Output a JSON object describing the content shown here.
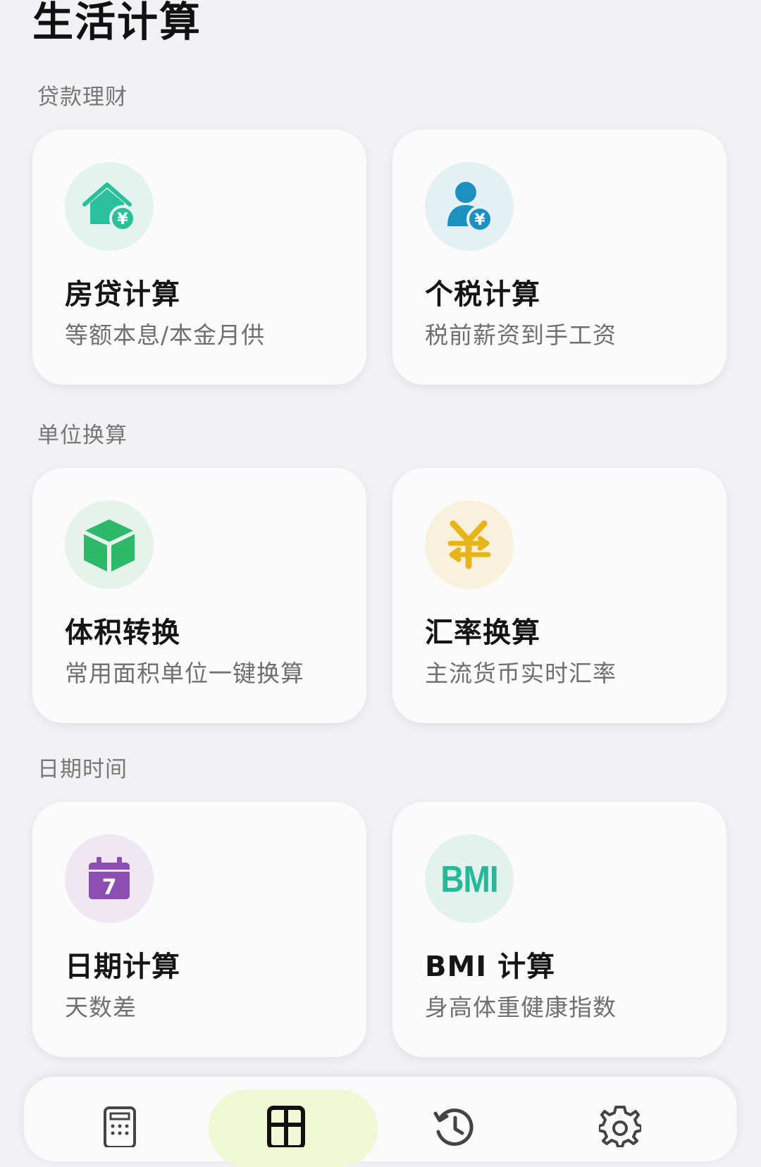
{
  "page": {
    "title": "生活计算"
  },
  "sections": [
    {
      "title": "贷款理财",
      "cards": [
        {
          "title": "房贷计算",
          "subtitle": "等额本息/本金月供",
          "icon": "house-yuan-icon",
          "icon_color": "#2bbf9c",
          "icon_bg": "#e3f4ef"
        },
        {
          "title": "个税计算",
          "subtitle": "税前薪资到手工资",
          "icon": "person-yuan-icon",
          "icon_color": "#1d8fc0",
          "icon_bg": "#e3f0f4"
        }
      ]
    },
    {
      "title": "单位换算",
      "cards": [
        {
          "title": "体积转换",
          "subtitle": "常用面积单位一键换算",
          "icon": "cube-icon",
          "icon_color": "#2eb86a",
          "icon_bg": "#e5f3ea"
        },
        {
          "title": "汇率换算",
          "subtitle": "主流货币实时汇率",
          "icon": "yuan-exchange-icon",
          "icon_color": "#e8b41c",
          "icon_bg": "#f9f1dc"
        }
      ]
    },
    {
      "title": "日期时间",
      "cards": [
        {
          "title": "日期计算",
          "subtitle": "天数差",
          "icon": "calendar-icon",
          "icon_color": "#8a4fb0",
          "icon_bg": "#efe7f2",
          "icon_text": "7"
        },
        {
          "title": "BMI 计算",
          "subtitle": "身高体重健康指数",
          "icon": "bmi-icon",
          "icon_color": "#25b899",
          "icon_bg": "#e2f3ee",
          "icon_text": "BMI"
        }
      ]
    }
  ],
  "bottom_nav": {
    "active_color": "#eff7d5",
    "items": [
      {
        "icon": "calculator-icon",
        "active": false
      },
      {
        "icon": "grid-icon",
        "active": true
      },
      {
        "icon": "history-icon",
        "active": false
      },
      {
        "icon": "settings-gear-icon",
        "active": false
      }
    ]
  }
}
